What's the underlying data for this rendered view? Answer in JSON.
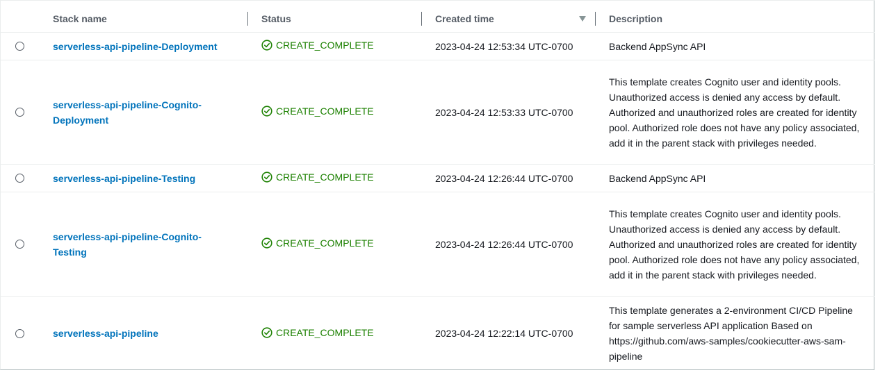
{
  "table": {
    "columns": {
      "name": "Stack name",
      "status": "Status",
      "created": "Created time",
      "description": "Description"
    },
    "rows": [
      {
        "name": "serverless-api-pipeline-Deployment",
        "status": "CREATE_COMPLETE",
        "created": "2023-04-24 12:53:34 UTC-0700",
        "description": "Backend AppSync API"
      },
      {
        "name": "serverless-api-pipeline-Cognito-Deployment",
        "status": "CREATE_COMPLETE",
        "created": "2023-04-24 12:53:33 UTC-0700",
        "description": "This template creates Cognito user and identity pools. Unauthorized access is denied any access by default. Authorized and unauthorized roles are created for identity pool. Authorized role does not have any policy associated, add it in the parent stack with privileges needed."
      },
      {
        "name": "serverless-api-pipeline-Testing",
        "status": "CREATE_COMPLETE",
        "created": "2023-04-24 12:26:44 UTC-0700",
        "description": "Backend AppSync API"
      },
      {
        "name": "serverless-api-pipeline-Cognito-Testing",
        "status": "CREATE_COMPLETE",
        "created": "2023-04-24 12:26:44 UTC-0700",
        "description": "This template creates Cognito user and identity pools. Unauthorized access is denied any access by default. Authorized and unauthorized roles are created for identity pool. Authorized role does not have any policy associated, add it in the parent stack with privileges needed."
      },
      {
        "name": "serverless-api-pipeline",
        "status": "CREATE_COMPLETE",
        "created": "2023-04-24 12:22:14 UTC-0700",
        "description": "This template generates a 2-environment CI/CD Pipeline for sample serverless API application Based on https://github.com/aws-samples/cookiecutter-aws-sam-pipeline"
      }
    ],
    "sort": {
      "column": "created",
      "direction": "descending"
    }
  },
  "icons": {
    "status": "check-circle-icon",
    "sort": "caret-down-icon"
  },
  "colors": {
    "link": "#0073bb",
    "success": "#1d8102",
    "header_text": "#545b64",
    "border": "#eaeded"
  }
}
